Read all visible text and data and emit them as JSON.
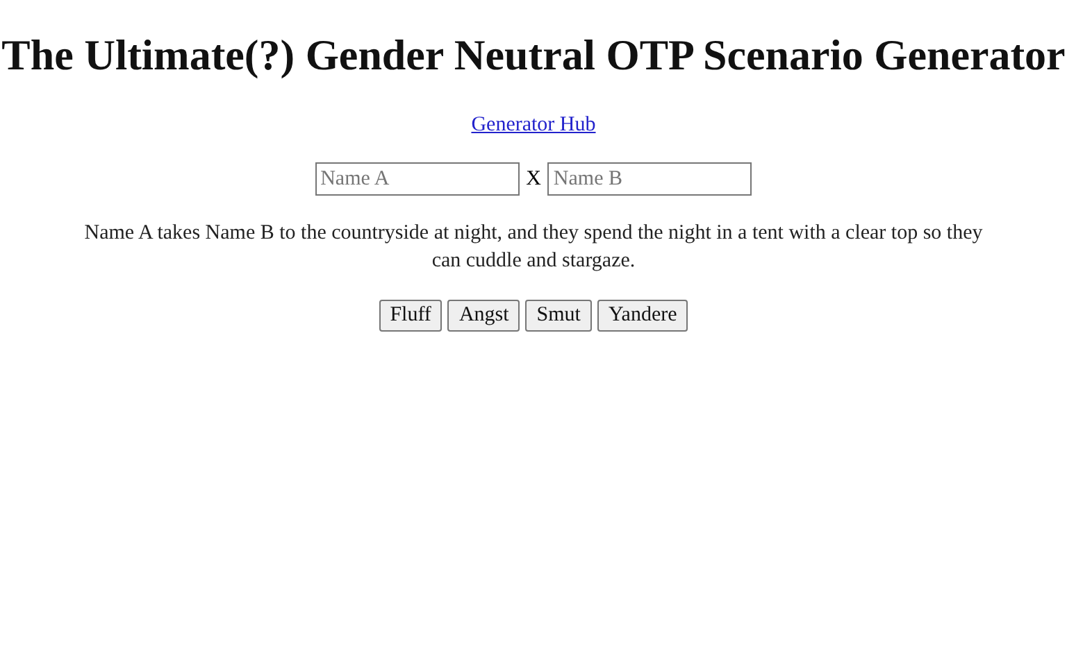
{
  "title": "The Ultimate(?) Gender Neutral OTP Scenario Generator",
  "hub_link": "Generator Hub",
  "names": {
    "name_a": {
      "placeholder": "Name A"
    },
    "separator": "X",
    "name_b": {
      "placeholder": "Name B"
    }
  },
  "scenario": "Name A takes Name B to the countryside at night, and they spend the night in a tent with a clear top so they can cuddle and stargaze.",
  "buttons": [
    "Fluff",
    "Angst",
    "Smut",
    "Yandere"
  ]
}
